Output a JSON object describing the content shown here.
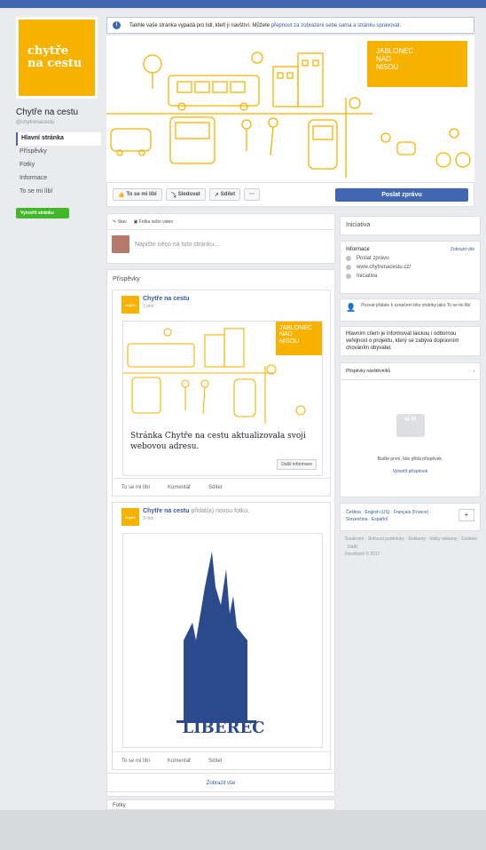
{
  "page": {
    "name": "Chytře na cestu",
    "handle": "@chytrenacestu",
    "logo_line1": "chytře",
    "logo_line2": "na cestu"
  },
  "nav": {
    "items": [
      "Hlavní stránka",
      "Příspěvky",
      "Fotky",
      "Informace",
      "To se mi líbí"
    ],
    "create_label": "Vytvořit stránku"
  },
  "notice": {
    "text": "Takhle vaše stránka vypadá pro lidi, kteří ji navštíví. Můžete",
    "link": "přepnout za zobrazení sebe sama a stránku spravovat."
  },
  "cover": {
    "jab_l1": "JABLONEC",
    "jab_l2": "NAD",
    "jab_l3": "NISOU",
    "accent": "#f7b200"
  },
  "actions": {
    "like": "To se mi líbí",
    "follow": "Sledovat",
    "share": "Sdílet",
    "more": "···",
    "message": "Poslat zprávu"
  },
  "composer": {
    "status": "Stav",
    "photo": "Fotka nebo video",
    "placeholder": "Napište něco na tuto stránku..."
  },
  "posts": {
    "heading": "Příspěvky",
    "show_all": "Zobrazit vše",
    "photos_heading": "Fotky"
  },
  "post1": {
    "author": "Chytře na cestu",
    "time": "2 min · ",
    "headline": "Stránka Chytře na cestu aktualizovala svoji webovou adresu.",
    "more": "Další informace",
    "jab_l1": "JABLONEC",
    "jab_l2": "NAD",
    "jab_l3": "NISOU"
  },
  "post2": {
    "author": "Chytře na cestu",
    "suffix": "přidal(a) novou fotku.",
    "time": "3 min · ",
    "logo_text": "LIBEREC"
  },
  "post_actions": {
    "like": "To se mi líbí",
    "comment": "Komentář",
    "share": "Sdílet"
  },
  "right": {
    "category": "Iniciativa",
    "info_heading": "Informace",
    "show_all": "Zobrazit vše",
    "send_message": "Poslat zprávu",
    "website": "www.chytrenacestu.cz/",
    "category_item": "Iniciativa",
    "invite": "Pozvat přátele k označení této stránky jako To se mi líbí",
    "about": "Hlavním cílem je informovat laickou i odbornou veřejnost o projektu, který se zabývá dopravním chováním obyvatel.",
    "visitors_heading": "Příspěvky návštěvníků",
    "visitors_empty": "Buďte první, kdo přidá příspěvek.",
    "write_post": "Vytvořit příspěvek",
    "languages": "Čeština · English (US) · Français (France) · Slovenčina · Español",
    "plus": "+",
    "footer": "Soukromí · Smluvní podmínky · Reklamy · Volby reklamy · Cookies · Další",
    "copyright": "Facebook © 2017"
  }
}
